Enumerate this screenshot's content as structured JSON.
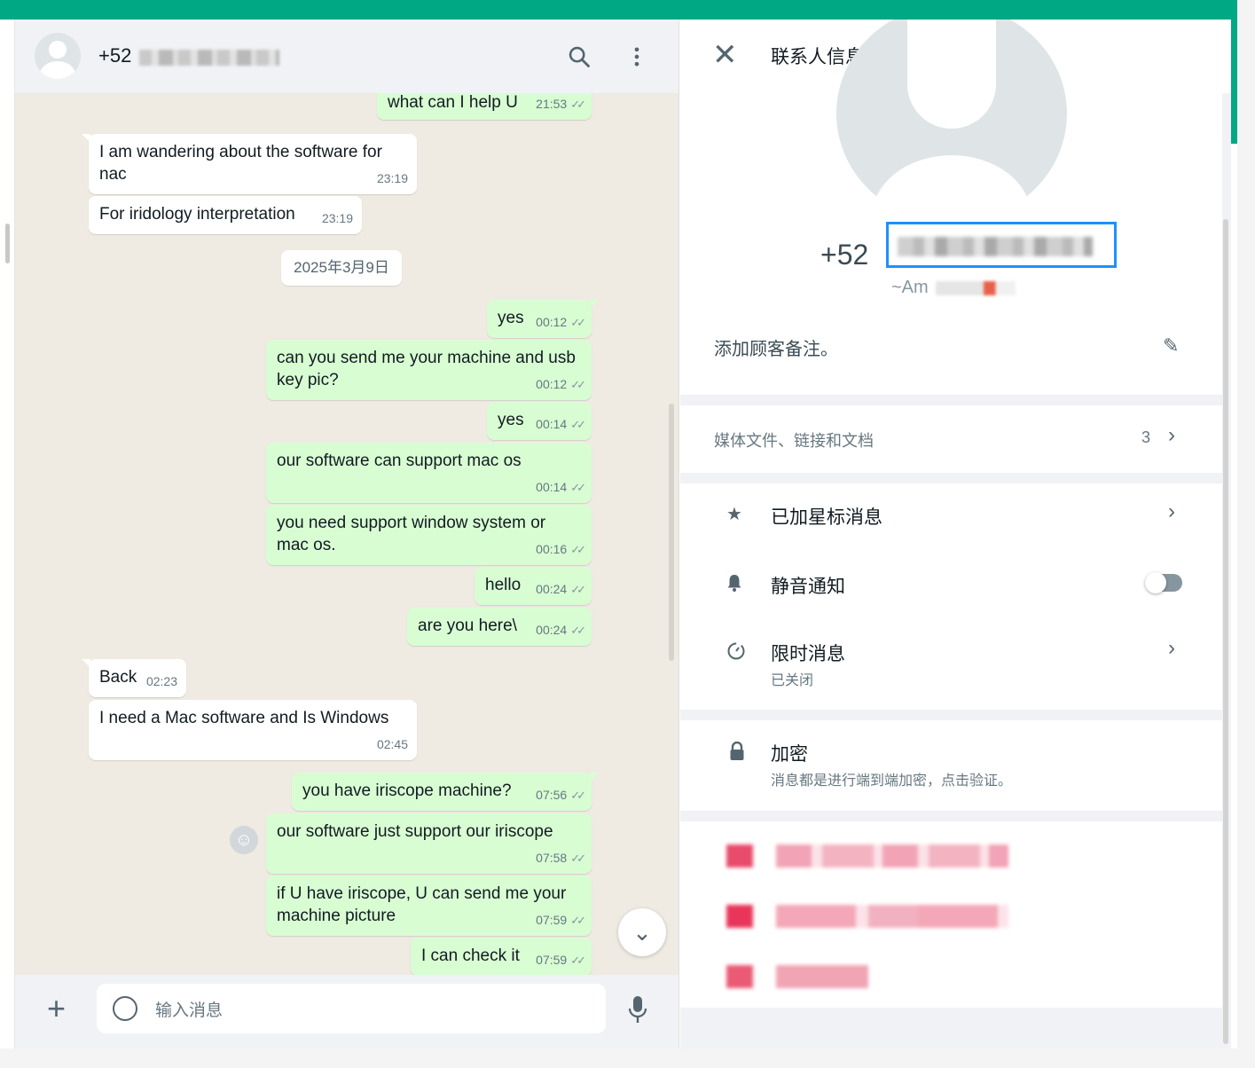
{
  "chat": {
    "contact_number": "+52",
    "composer_placeholder": "输入消息",
    "date_chip": "2025年3月9日",
    "messages": [
      {
        "dir": "out",
        "text": "what can I help U",
        "time": "21:53"
      },
      {
        "dir": "in",
        "text": "I am wandering about the software for nac",
        "time": "23:19"
      },
      {
        "dir": "in",
        "text": "For iridology interpretation",
        "time": "23:19"
      },
      {
        "dir": "out",
        "text": "yes",
        "time": "00:12"
      },
      {
        "dir": "out",
        "text": "can you send me your machine and usb key pic?",
        "time": "00:12"
      },
      {
        "dir": "out",
        "text": "yes",
        "time": "00:14"
      },
      {
        "dir": "out",
        "text": "our software can support mac os",
        "time": "00:14"
      },
      {
        "dir": "out",
        "text": "you  need support window system or mac os.",
        "time": "00:16"
      },
      {
        "dir": "out",
        "text": "hello",
        "time": "00:24"
      },
      {
        "dir": "out",
        "text": "are you here\\",
        "time": "00:24"
      },
      {
        "dir": "in",
        "text": "Back",
        "time": "02:23"
      },
      {
        "dir": "in",
        "text": "I need a Mac software and Is Windows",
        "time": "02:45"
      },
      {
        "dir": "out",
        "text": "you have  iriscope machine?",
        "time": "07:56"
      },
      {
        "dir": "out",
        "text": "our software just support our iriscope",
        "time": "07:58"
      },
      {
        "dir": "out",
        "text": "if U have iriscope, U can send me your machine picture",
        "time": "07:59"
      },
      {
        "dir": "out",
        "text": "I can check it",
        "time": "07:59"
      }
    ]
  },
  "info": {
    "title": "联系人信息",
    "number": "+52",
    "subname": "~Am",
    "note": "添加顾客备注。",
    "media_label": "媒体文件、链接和文档",
    "media_count": "3",
    "starred": "已加星标消息",
    "mute": "静音通知",
    "mute_on": false,
    "disappearing": "限时消息",
    "disappearing_status": "已关闭",
    "encryption": "加密",
    "encryption_desc": "消息都是进行端到端加密，点击验证。"
  },
  "colors": {
    "accent": "#00a884",
    "outgoing": "#d9fdd3",
    "incoming": "#ffffff",
    "selection": "#1e90ff"
  }
}
